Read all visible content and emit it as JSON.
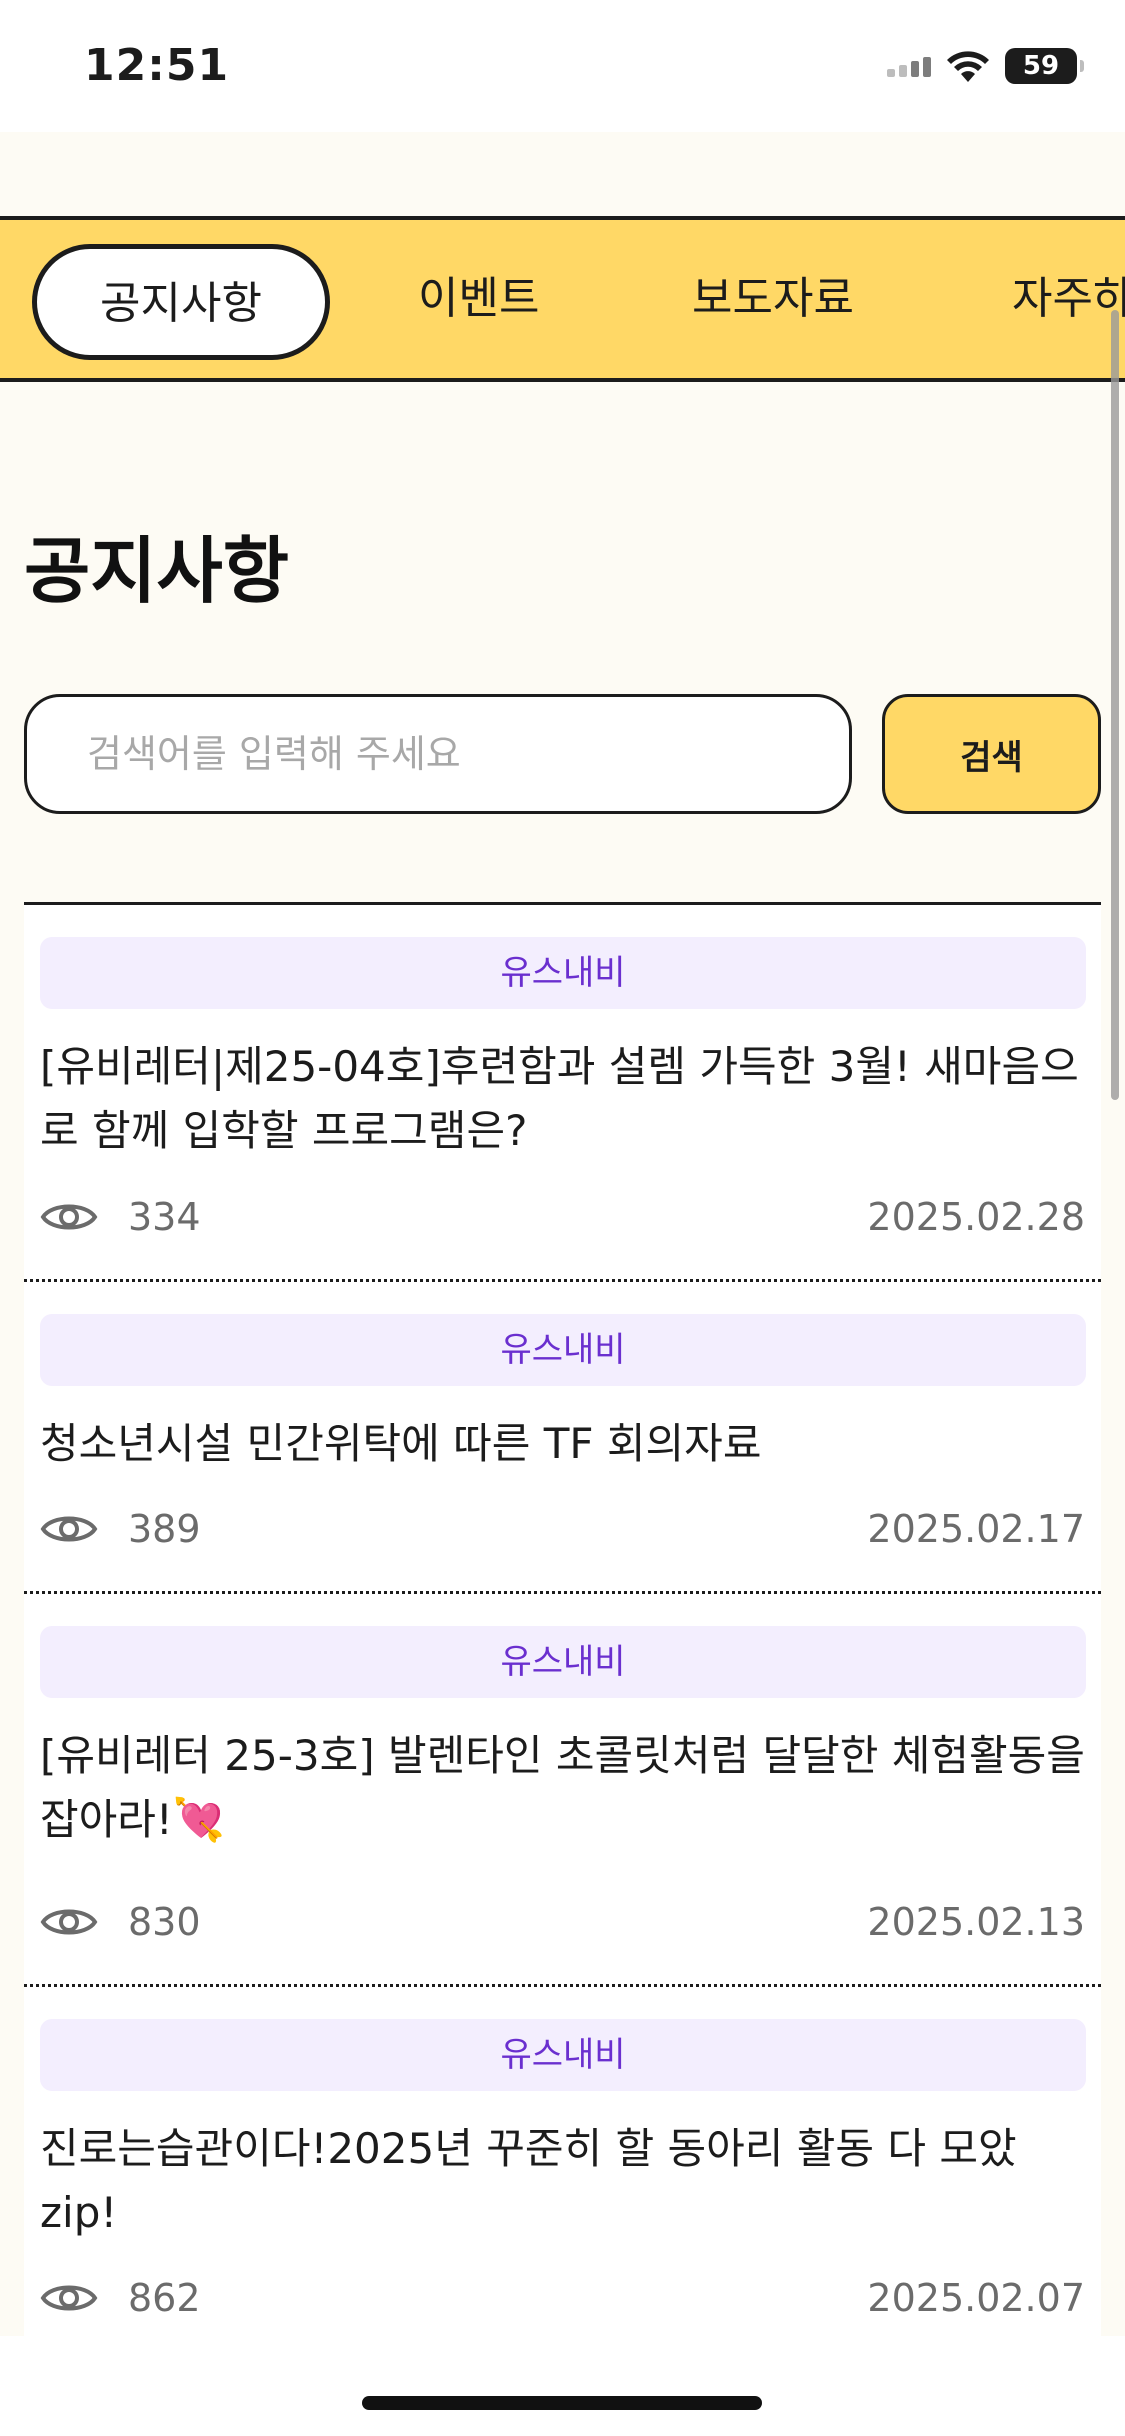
{
  "status_bar": {
    "time": "12:51",
    "battery": "59"
  },
  "tabs": [
    {
      "label": "공지사항",
      "active": true
    },
    {
      "label": "이벤트",
      "active": false
    },
    {
      "label": "보도자료",
      "active": false
    },
    {
      "label": "자주하",
      "active": false
    }
  ],
  "page": {
    "title": "공지사항"
  },
  "search": {
    "placeholder": "검색어를 입력해 주세요",
    "value": "",
    "button_label": "검색"
  },
  "notices": [
    {
      "category": "유스내비",
      "title": "[유비레터|제25-04호]후련함과 설렘 가득한 3월! 새마음으로 함께 입학할 프로그램은?",
      "views": "334",
      "date": "2025.02.28"
    },
    {
      "category": "유스내비",
      "title": "청소년시설 민간위탁에 따른 TF 회의자료",
      "views": "389",
      "date": "2025.02.17"
    },
    {
      "category": "유스내비",
      "title": "[유비레터 25-3호] 발렌타인 초콜릿처럼 달달한 체험활동을 잡아라!💘",
      "views": "830",
      "date": "2025.02.13"
    },
    {
      "category": "유스내비",
      "title": "진로는습관이다!2025년 꾸준히 할 동아리 활동 다 모았zip!",
      "views": "862",
      "date": "2025.02.07"
    }
  ],
  "colors": {
    "accent_yellow": "#ffd866",
    "badge_bg": "#f3eefe",
    "badge_text": "#6a2fcf",
    "background": "#fdfbf4"
  }
}
